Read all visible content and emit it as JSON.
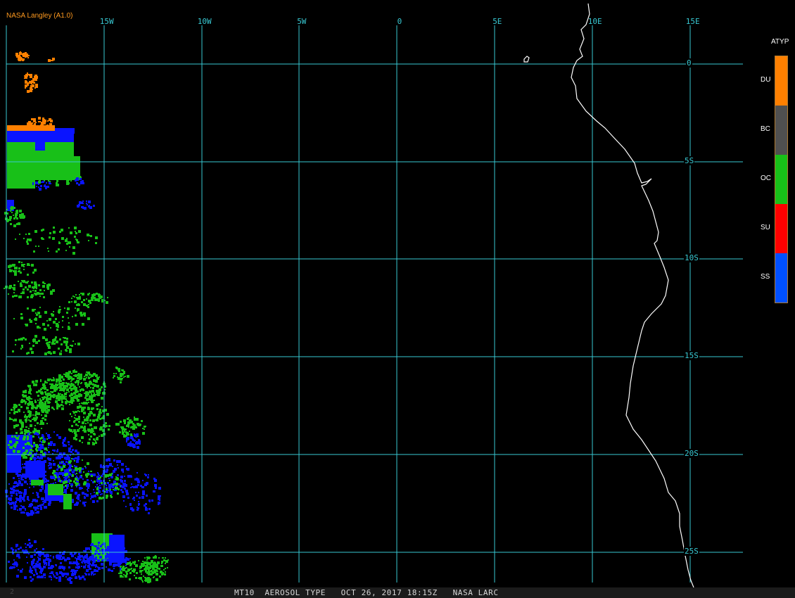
{
  "credit": "NASA Langley (A1.0)",
  "lon_labels": [
    "15W",
    "10W",
    "5W",
    "0",
    "5E",
    "10E",
    "15E"
  ],
  "lat_labels": [
    "0",
    "5S",
    "10S",
    "15S",
    "20S",
    "25S"
  ],
  "legend": {
    "title": "ATYP",
    "items": [
      {
        "code": "DU",
        "color": "#ff8000"
      },
      {
        "code": "BC",
        "color": "#505050"
      },
      {
        "code": "OC",
        "color": "#18c018"
      },
      {
        "code": "SU",
        "color": "#ff0000"
      },
      {
        "code": "SS",
        "color": "#0050ff"
      }
    ]
  },
  "footer": {
    "text": "MT10  AEROSOL TYPE   OCT 26, 2017 18:15Z   NASA LARC",
    "mark": "2"
  },
  "colors": {
    "grid": "#38c8d2",
    "coast": "#ffffff",
    "du": "#ff8000",
    "oc": "#18c018",
    "ss": "#0a14ff"
  }
}
